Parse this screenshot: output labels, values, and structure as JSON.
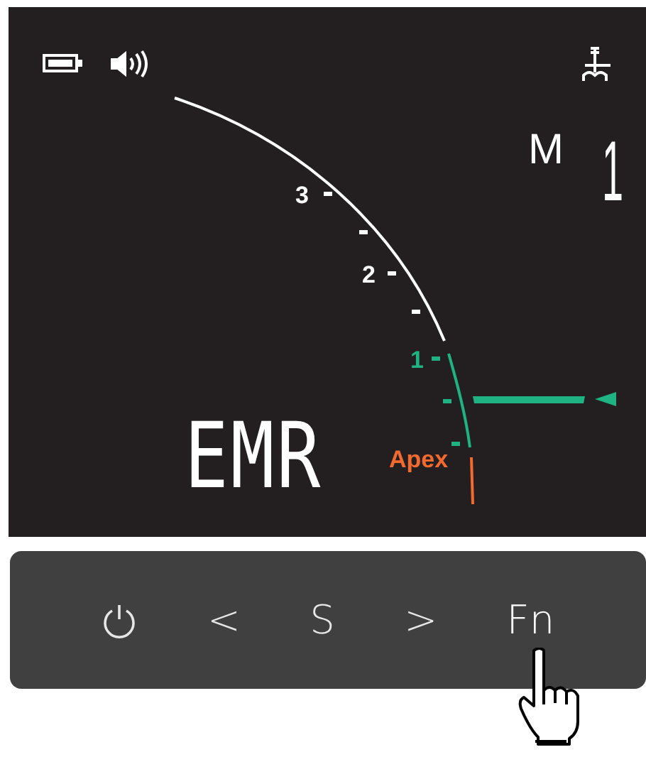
{
  "display": {
    "mode": {
      "label": "M",
      "value": "1"
    },
    "scale": [
      {
        "text": "3",
        "color": "#ffffff"
      },
      {
        "text": "2",
        "color": "#ffffff"
      },
      {
        "text": "1",
        "color": "#1fb383"
      }
    ],
    "apex_label": "Apex",
    "readout": "EMR"
  },
  "buttons": [
    {
      "kind": "power",
      "pressed": false
    },
    {
      "kind": "text",
      "label": "<",
      "pressed": false
    },
    {
      "kind": "text",
      "label": "S",
      "pressed": false
    },
    {
      "kind": "text",
      "label": ">",
      "pressed": false
    },
    {
      "kind": "text",
      "label": "Fn",
      "pressed": true
    }
  ]
}
